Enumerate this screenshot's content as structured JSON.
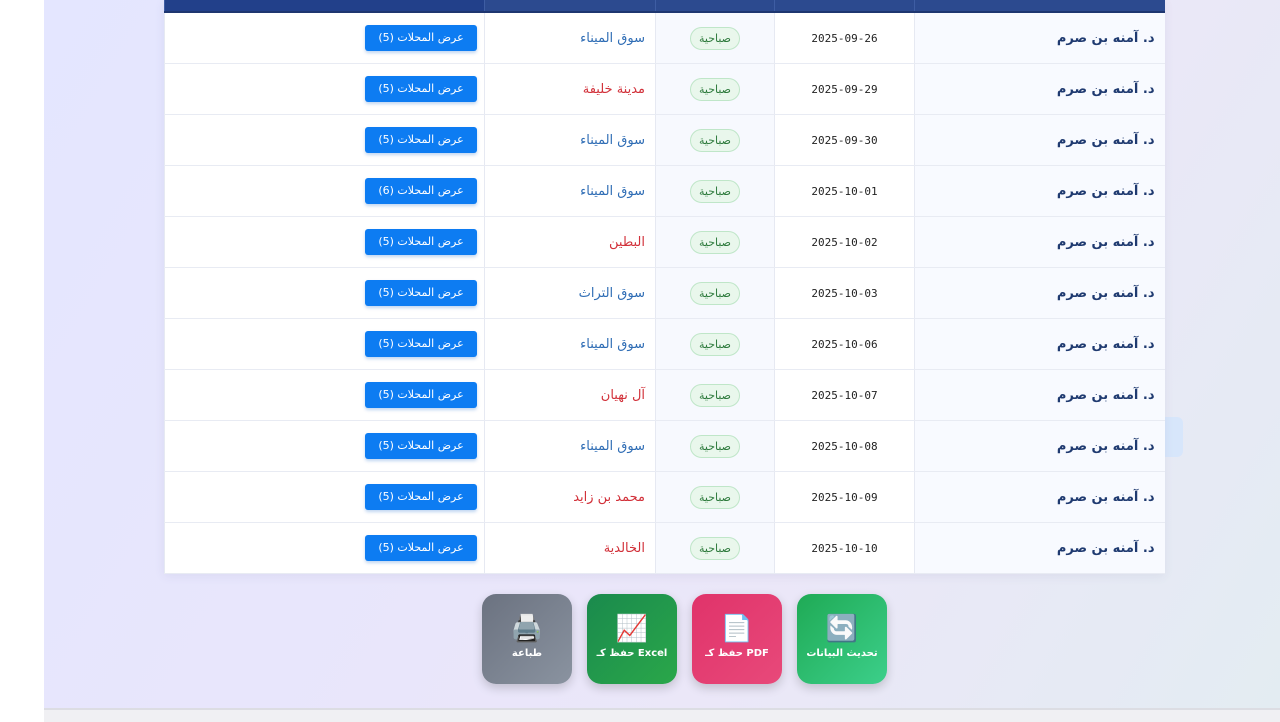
{
  "table": {
    "rows": [
      {
        "doctor": "د. آمنه بن صرم",
        "date": "2025-09-26",
        "shift": "صباحية",
        "location": "سوق الميناء",
        "location_color": "#2f6db5",
        "button": "عرض المحلات (5)"
      },
      {
        "doctor": "د. آمنه بن صرم",
        "date": "2025-09-29",
        "shift": "صباحية",
        "location": "مدينة خليفة",
        "location_color": "#d2313a",
        "button": "عرض المحلات (5)"
      },
      {
        "doctor": "د. آمنه بن صرم",
        "date": "2025-09-30",
        "shift": "صباحية",
        "location": "سوق الميناء",
        "location_color": "#2f6db5",
        "button": "عرض المحلات (5)"
      },
      {
        "doctor": "د. آمنه بن صرم",
        "date": "2025-10-01",
        "shift": "صباحية",
        "location": "سوق الميناء",
        "location_color": "#2f6db5",
        "button": "عرض المحلات (6)"
      },
      {
        "doctor": "د. آمنه بن صرم",
        "date": "2025-10-02",
        "shift": "صباحية",
        "location": "البطين",
        "location_color": "#d2313a",
        "button": "عرض المحلات (5)"
      },
      {
        "doctor": "د. آمنه بن صرم",
        "date": "2025-10-03",
        "shift": "صباحية",
        "location": "سوق التراث",
        "location_color": "#2f6db5",
        "button": "عرض المحلات (5)"
      },
      {
        "doctor": "د. آمنه بن صرم",
        "date": "2025-10-06",
        "shift": "صباحية",
        "location": "سوق الميناء",
        "location_color": "#2f6db5",
        "button": "عرض المحلات (5)"
      },
      {
        "doctor": "د. آمنه بن صرم",
        "date": "2025-10-07",
        "shift": "صباحية",
        "location": "آل نهيان",
        "location_color": "#d2313a",
        "button": "عرض المحلات (5)"
      },
      {
        "doctor": "د. آمنه بن صرم",
        "date": "2025-10-08",
        "shift": "صباحية",
        "location": "سوق الميناء",
        "location_color": "#2f6db5",
        "button": "عرض المحلات (5)"
      },
      {
        "doctor": "د. آمنه بن صرم",
        "date": "2025-10-09",
        "shift": "صباحية",
        "location": "محمد بن زايد",
        "location_color": "#d2313a",
        "button": "عرض المحلات (5)"
      },
      {
        "doctor": "د. آمنه بن صرم",
        "date": "2025-10-10",
        "shift": "صباحية",
        "location": "الخالدية",
        "location_color": "#d2313a",
        "button": "عرض المحلات (5)"
      }
    ]
  },
  "actions": {
    "refresh": {
      "label": "تحديث البيانات",
      "icon": "refresh-icon",
      "glyph": "🔄",
      "color": "#1faa55"
    },
    "pdf": {
      "label": "حفظ كـ PDF",
      "icon": "document-icon",
      "glyph": "📄",
      "color": "#e0336a"
    },
    "excel": {
      "label": "حفظ كـ Excel",
      "icon": "chart-icon",
      "glyph": "📈",
      "color": "#1a8a4d"
    },
    "print": {
      "label": "طباعة",
      "icon": "printer-icon",
      "glyph": "🖨️",
      "color": "#6b7280"
    }
  }
}
